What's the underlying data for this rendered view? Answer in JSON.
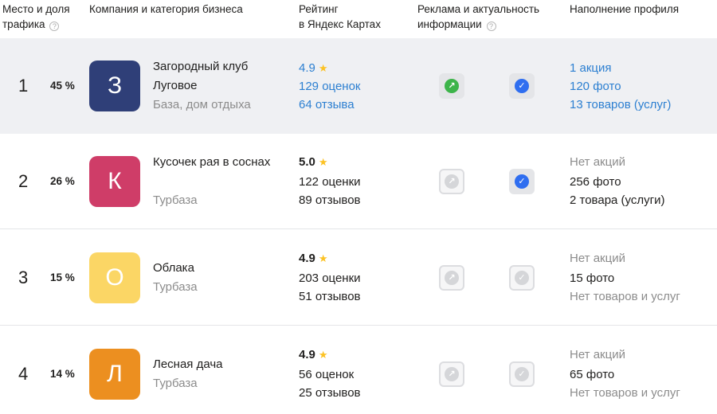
{
  "header": {
    "place_line1": "Место и доля",
    "place_line2": "трафика",
    "company": "Компания и категория бизнеса",
    "rating_line1": "Рейтинг",
    "rating_line2": "в Яндекс Картах",
    "ads_line1": "Реклама и актуальность",
    "ads_line2": "информации",
    "profile": "Наполнение профиля",
    "help_icon": "question-circle-icon"
  },
  "colors": {
    "highlight_row": "#eff0f3",
    "link_blue": "#2c7fd1",
    "ad_active_green": "#3db44a",
    "verified_blue": "#2f6ef0",
    "inactive_grey": "#d5d6d9",
    "star": "#fcc223"
  },
  "rows": [
    {
      "place": "1",
      "share": "45 %",
      "letter": "З",
      "avatar_color": "#2f3f78",
      "name": "Загородный клуб Луговое",
      "category": "База, дом отдыха",
      "rating": "4.9",
      "ratings_count": "129 оценок",
      "reviews": "64 отзыва",
      "ad_active": true,
      "verified": true,
      "promo": "1 акция",
      "photos": "120 фото",
      "goods": "13 товаров (услуг)",
      "highlight": true
    },
    {
      "place": "2",
      "share": "26 %",
      "letter": "К",
      "avatar_color": "#cf3d68",
      "name": "Кусочек рая в соснах",
      "category": "Турбаза",
      "rating": "5.0",
      "ratings_count": "122 оценки",
      "reviews": "89 отзывов",
      "ad_active": false,
      "verified": true,
      "promo": "Нет акций",
      "photos": "256 фото",
      "goods": "2 товара (услуги)",
      "highlight": false
    },
    {
      "place": "3",
      "share": "15 %",
      "letter": "О",
      "avatar_color": "#fbd665",
      "name": "Облака",
      "category": "Турбаза",
      "rating": "4.9",
      "ratings_count": "203 оценки",
      "reviews": "51 отзывов",
      "ad_active": false,
      "verified": false,
      "promo": "Нет акций",
      "photos": "15 фото",
      "goods": "Нет товаров и услуг",
      "highlight": false
    },
    {
      "place": "4",
      "share": "14 %",
      "letter": "Л",
      "avatar_color": "#ec8f20",
      "name": "Лесная дача",
      "category": "Турбаза",
      "rating": "4.9",
      "ratings_count": "56 оценок",
      "reviews": "25 отзывов",
      "ad_active": false,
      "verified": false,
      "promo": "Нет акций",
      "photos": "65 фото",
      "goods": "Нет товаров и услуг",
      "highlight": false
    }
  ]
}
